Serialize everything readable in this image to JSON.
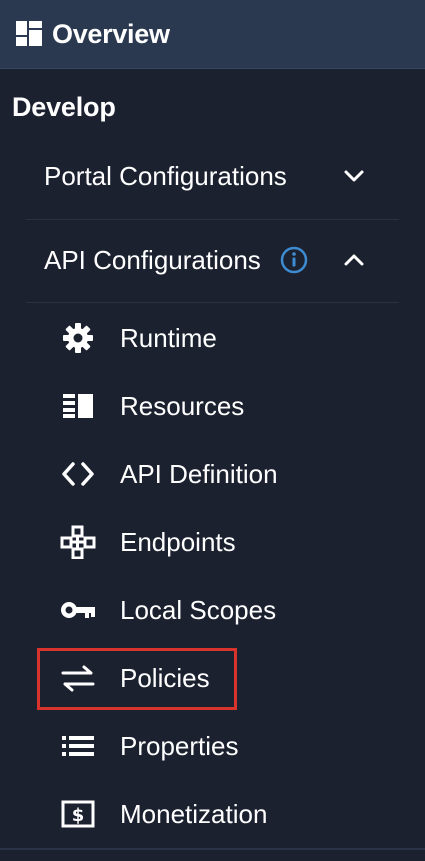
{
  "header": {
    "title": "Overview",
    "logo_icon": "dashboard-grid-icon",
    "background": "#2a3950"
  },
  "section": {
    "label": "Develop"
  },
  "groups": [
    {
      "label": "Portal Configurations",
      "state": "collapsed",
      "chevron": "chevron-down-icon"
    },
    {
      "label": "API Configurations",
      "state": "expanded",
      "chevron": "chevron-up-icon",
      "info_icon": "info-icon",
      "info_color": "#3d8bd1"
    }
  ],
  "api_items": [
    {
      "label": "Runtime",
      "icon": "gear-icon"
    },
    {
      "label": "Resources",
      "icon": "resources-icon"
    },
    {
      "label": "API Definition",
      "icon": "code-icon"
    },
    {
      "label": "Endpoints",
      "icon": "endpoints-icon"
    },
    {
      "label": "Local Scopes",
      "icon": "key-icon"
    },
    {
      "label": "Policies",
      "icon": "arrows-exchange-icon",
      "highlighted": true,
      "highlight_color": "#d9342b"
    },
    {
      "label": "Properties",
      "icon": "list-icon"
    },
    {
      "label": "Monetization",
      "icon": "dollar-icon"
    }
  ]
}
